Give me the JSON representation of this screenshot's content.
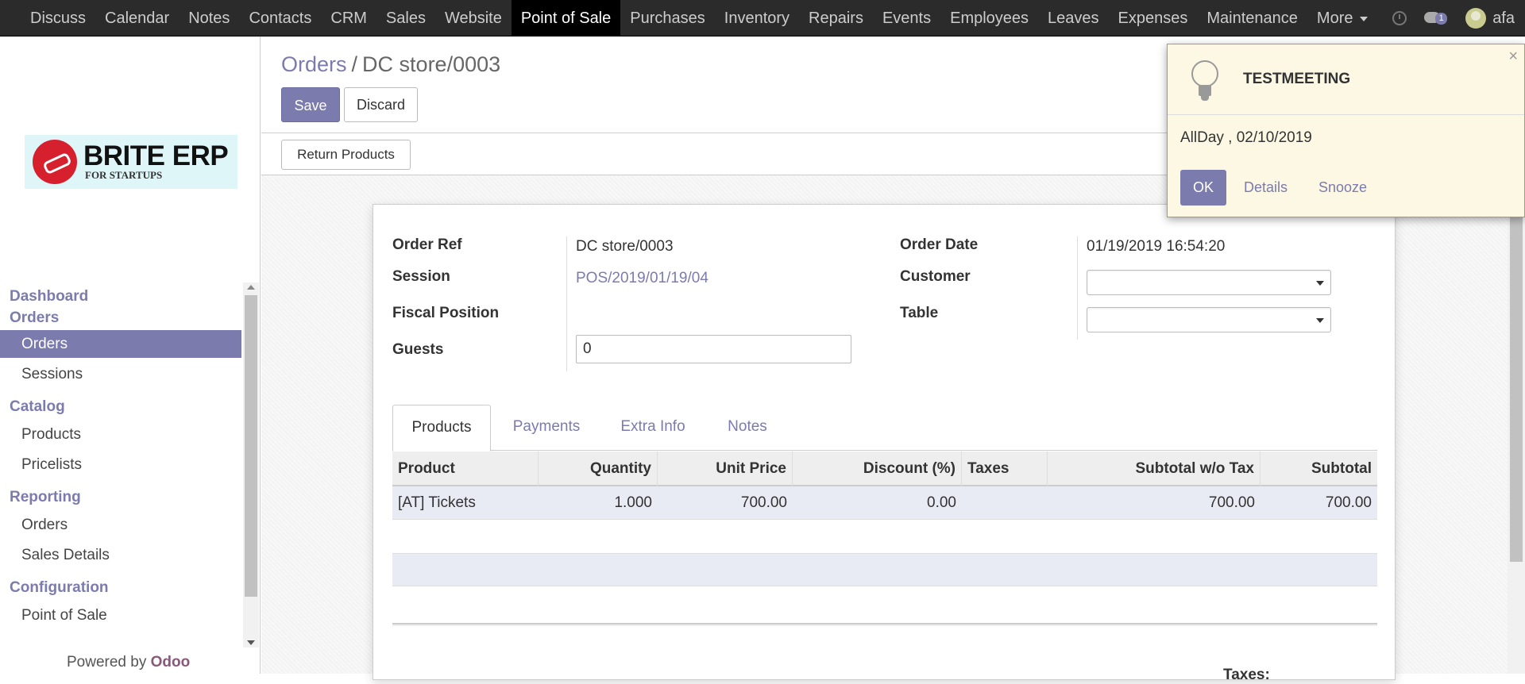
{
  "topbar": {
    "menu": [
      "Discuss",
      "Calendar",
      "Notes",
      "Contacts",
      "CRM",
      "Sales",
      "Website",
      "Point of Sale",
      "Purchases",
      "Inventory",
      "Repairs",
      "Events",
      "Employees",
      "Leaves",
      "Expenses",
      "Maintenance"
    ],
    "active": "Point of Sale",
    "more_label": "More",
    "chat_count": "1",
    "user_name": "afa"
  },
  "sidebar": {
    "logo_title": "BRITE ERP",
    "logo_subtitle": "FOR STARTUPS",
    "sections": [
      {
        "title": "Dashboard",
        "items": []
      },
      {
        "title": "Orders",
        "items": [
          "Orders",
          "Sessions"
        ]
      },
      {
        "title": "Catalog",
        "items": [
          "Products",
          "Pricelists"
        ]
      },
      {
        "title": "Reporting",
        "items": [
          "Orders",
          "Sales Details"
        ]
      },
      {
        "title": "Configuration",
        "items": [
          "Point of Sale"
        ]
      }
    ],
    "active_item": "Orders",
    "powered_prefix": "Powered by",
    "powered_brand": "Odoo"
  },
  "breadcrumb": {
    "parent": "Orders",
    "separator": "/",
    "current": "DC store/0003"
  },
  "buttons": {
    "save": "Save",
    "discard": "Discard",
    "return_products": "Return Products"
  },
  "form": {
    "order_ref_label": "Order Ref",
    "order_ref": "DC store/0003",
    "session_label": "Session",
    "session": "POS/2019/01/19/04",
    "fiscal_position_label": "Fiscal Position",
    "guests_label": "Guests",
    "guests": "0",
    "order_date_label": "Order Date",
    "order_date": "01/19/2019 16:54:20",
    "customer_label": "Customer",
    "customer": "",
    "table_label": "Table",
    "table": ""
  },
  "tabs": [
    "Products",
    "Payments",
    "Extra Info",
    "Notes"
  ],
  "active_tab": "Products",
  "lines": {
    "headers": [
      "Product",
      "Quantity",
      "Unit Price",
      "Discount (%)",
      "Taxes",
      "Subtotal w/o Tax",
      "Subtotal"
    ],
    "rows": [
      [
        "[AT] Tickets",
        "1.000",
        "700.00",
        "0.00",
        "",
        "700.00",
        "700.00"
      ]
    ]
  },
  "totals": {
    "taxes_label": "Taxes:"
  },
  "notification": {
    "title": "TESTMEETING",
    "body": "AllDay , 02/10/2019",
    "ok": "OK",
    "details": "Details",
    "snooze": "Snooze",
    "close": "×"
  },
  "colors": {
    "accent": "#7c7bad",
    "topbar": "#2b2b2b",
    "notification_bg": "#fcf8e3"
  }
}
